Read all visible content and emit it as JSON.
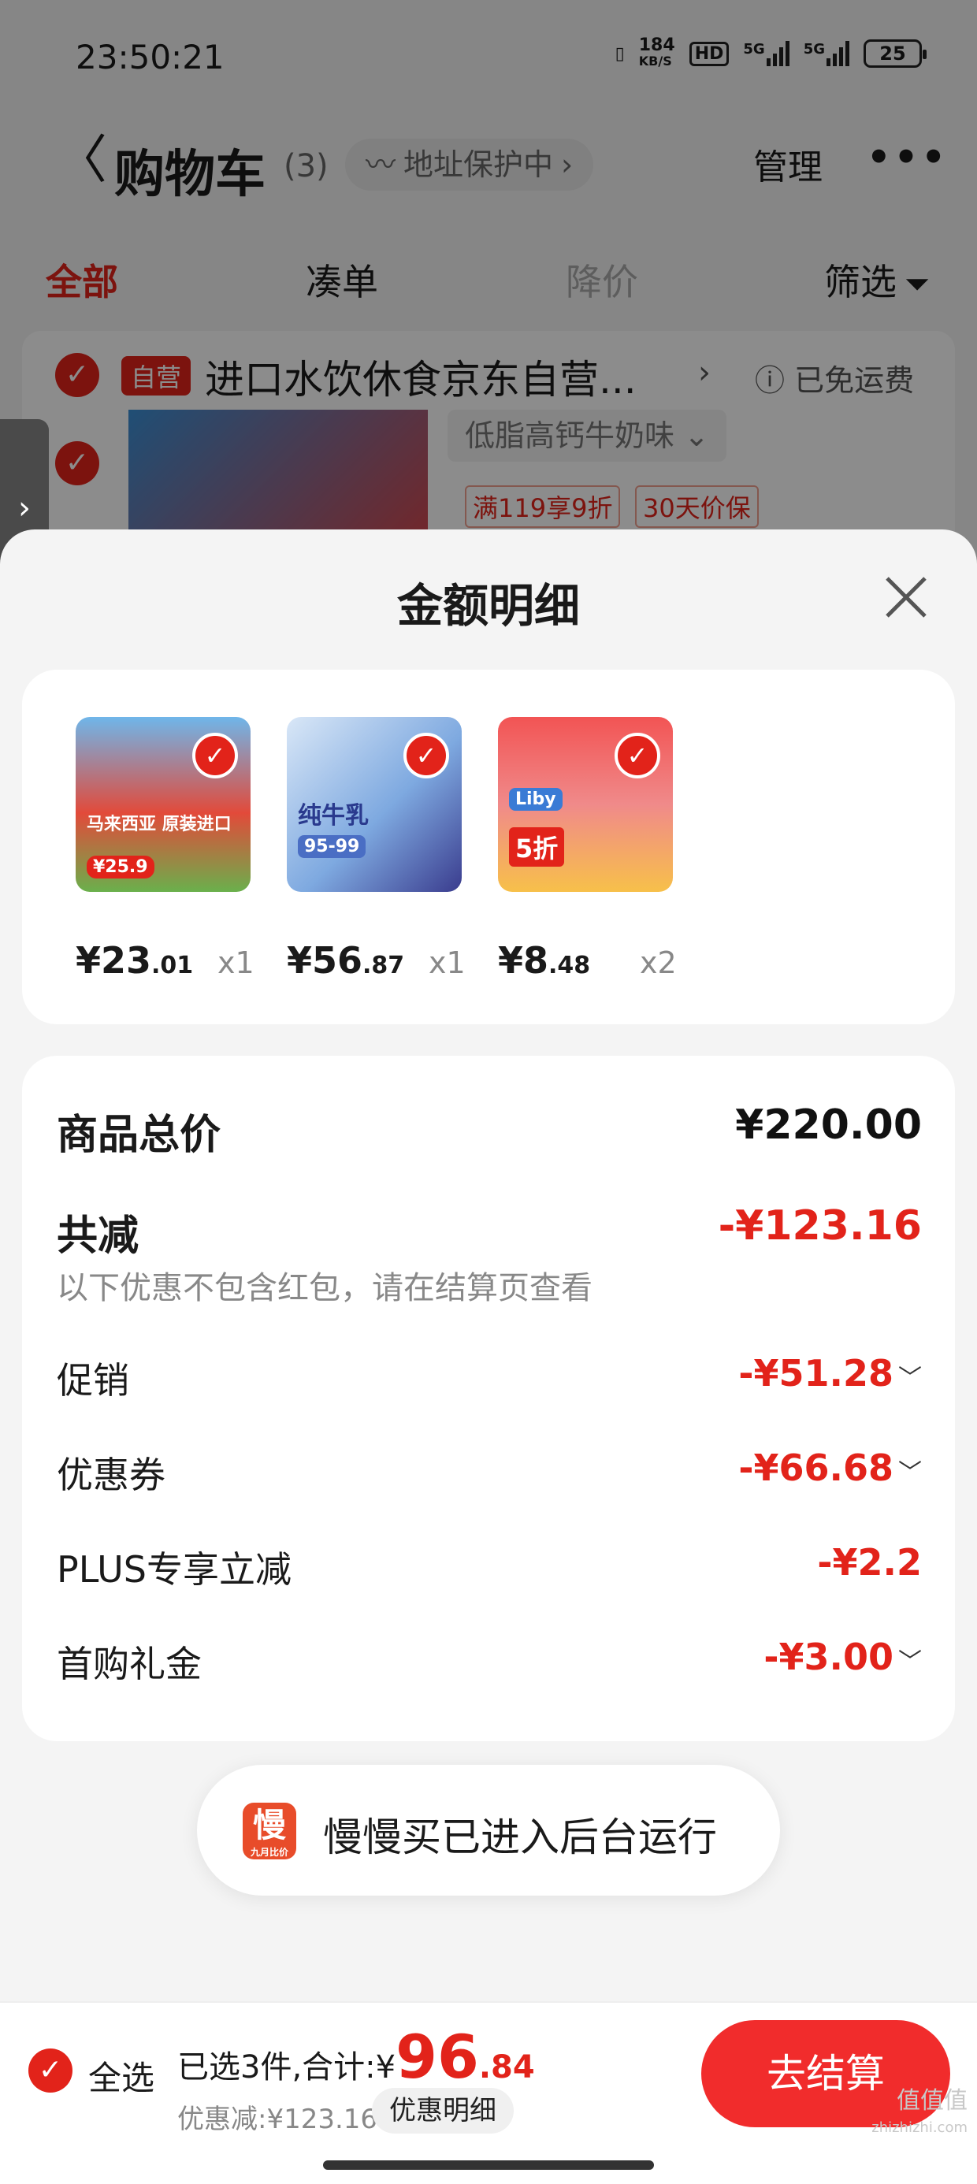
{
  "status_bar": {
    "time": "23:50:21",
    "speed_value": "184",
    "speed_unit": "KB/S",
    "hd": "HD",
    "net1": "5G",
    "net2": "5G",
    "battery": "25"
  },
  "header": {
    "back": "〈",
    "title": "购物车",
    "count": "(3)",
    "address_protect": "地址保护中",
    "manage": "管理",
    "more": "•••"
  },
  "tabs": [
    {
      "label": "全部"
    },
    {
      "label": "凑单"
    },
    {
      "label": "降价"
    },
    {
      "label": "筛选"
    }
  ],
  "shop": {
    "tag": "自营",
    "name": "进口水饮休食京东自营...",
    "shipping": "已免运费",
    "spec": "低脂高钙牛奶味",
    "promo1": "满119享9折",
    "promo2": "30天价保"
  },
  "sheet": {
    "title": "金额明细"
  },
  "products": [
    {
      "price_int": "¥23",
      "price_dec": ".01",
      "qty": "x1",
      "label": "马来西亚 原装进口",
      "badge": "¥25.9"
    },
    {
      "price_int": "¥56",
      "price_dec": ".87",
      "qty": "x1",
      "label": "纯牛乳",
      "badge": "95-99"
    },
    {
      "price_int": "¥8",
      "price_dec": ".48",
      "qty": "x2",
      "label": "Liby",
      "badge": "5折"
    }
  ],
  "summary": {
    "total_label": "商品总价",
    "total_value": "¥220.00",
    "reduce_label": "共减",
    "reduce_value": "-¥123.16",
    "note": "以下优惠不包含红包，请在结算页查看",
    "rows": [
      {
        "label": "促销",
        "value": "-¥51.28"
      },
      {
        "label": "优惠券",
        "value": "-¥66.68"
      },
      {
        "label": "PLUS专享立减",
        "value": "-¥2.2"
      },
      {
        "label": "首购礼金",
        "value": "-¥3.00"
      }
    ]
  },
  "toast": {
    "icon_char": "慢",
    "icon_sub": "九月比价",
    "text": "慢慢买已进入后台运行"
  },
  "bottom": {
    "select_all": "全选",
    "summary_prefix": "已选3件,合计:¥",
    "amount": "96",
    "cents": ".84",
    "discount": "优惠减:¥123.16",
    "detail": "优惠明细",
    "checkout": "去结算"
  },
  "watermark": {
    "main": "值值值",
    "sub": "zhizhizhi.com"
  },
  "colors": {
    "accent": "#e2231a",
    "button": "#f12c2c"
  }
}
